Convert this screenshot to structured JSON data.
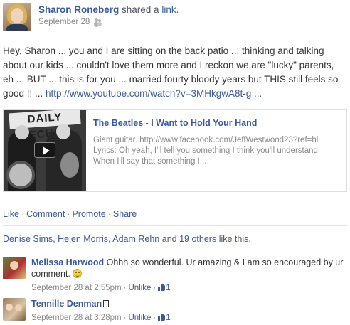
{
  "post": {
    "author": "Sharon Roneberg",
    "action_text": "shared a",
    "action_link": "link",
    "action_end": ".",
    "date": "September 28",
    "audience_icon": "friends-icon",
    "message": "Hey, Sharon ... you and I are sitting on the back patio ... thinking and talking about our kids ... couldn't love them more and I reckon we are \"lucky\" parents, eh ... BUT ... this is for you ... married fourty bloody years but THIS still feels so good !! ... ",
    "message_link": "http://www.youtube.com/watch?v=3MHkgwA8t-g ..."
  },
  "link_card": {
    "title": "The Beatles - I Want to Hold Your Hand",
    "description": "Giant guitar. http://www.facebook.com/JeffWestwood23?ref=hl\nLyrics: Oh yeah, I'll tell you something I think you'll understand\nWhen I'll say that something I...",
    "thumbnail_sign": "DAILY ECHO",
    "play_icon": "play-icon"
  },
  "actions": {
    "like": "Like",
    "comment": "Comment",
    "promote": "Promote",
    "share": "Share",
    "separator": "·"
  },
  "likes_summary": {
    "name1": "Denise Sims",
    "name2": "Helen Morris",
    "name3": "Adam Rehn",
    "connector": "and",
    "others": "19 others",
    "suffix": "like this."
  },
  "comments": [
    {
      "name": "Melissa Harwood",
      "text": "Ohhh so wonderful. Ur amazing & I am so encouraged by ur comment.",
      "has_smiley": true,
      "timestamp": "September 28 at 2:55pm",
      "unlike": "Unlike",
      "like_count": "1"
    },
    {
      "name": "Tennille Denman",
      "text": "",
      "timestamp": "September 28 at 3:28pm",
      "unlike": "Unlike",
      "like_count": "1"
    }
  ],
  "colors": {
    "link": "#3b5998",
    "meta": "#888888",
    "divider": "#e5e5e5"
  }
}
